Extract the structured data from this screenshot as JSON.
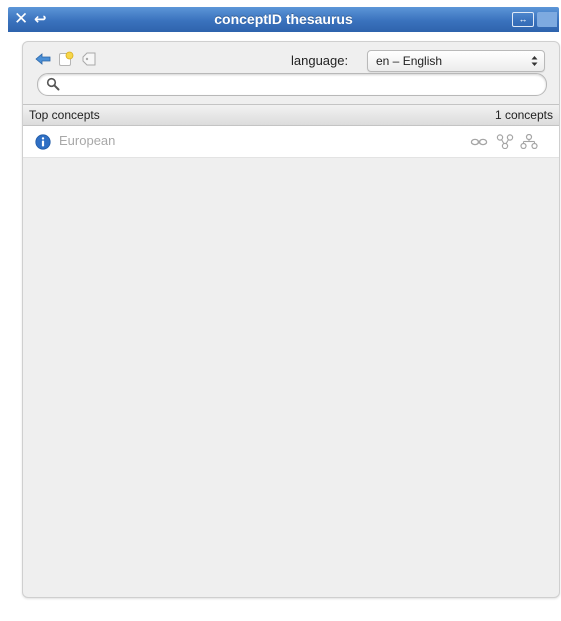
{
  "window": {
    "title": "conceptID thesaurus",
    "close_glyph": "✕",
    "back_glyph": "↩",
    "expand_glyph": "↔"
  },
  "toolbar": {
    "icons": [
      "back-arrow-icon",
      "new-concept-icon",
      "tag-icon"
    ],
    "language_label": "language:",
    "language_value": "en – English",
    "language_arrows": "▲▼"
  },
  "search": {
    "value": "",
    "placeholder": ""
  },
  "list": {
    "header_left": "Top concepts",
    "header_right": "1 concepts",
    "items": [
      {
        "label": "European",
        "icon": "info-icon",
        "actions": [
          "link-icon",
          "tree-icon",
          "hierarchy-icon"
        ]
      }
    ]
  },
  "colors": {
    "titlebar": "#3a72bd",
    "panel_bg": "#efefef",
    "row_text": "#a8a8a8",
    "info_blue": "#2f6fc4"
  }
}
